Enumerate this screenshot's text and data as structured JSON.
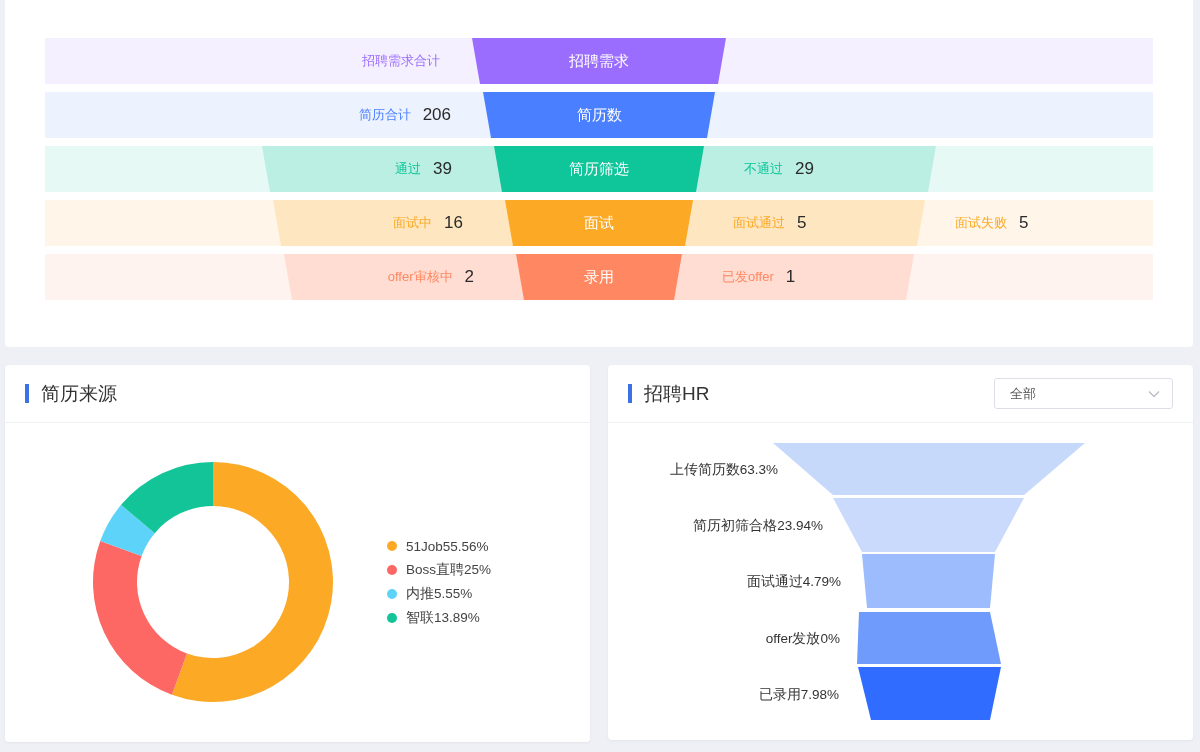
{
  "funnel": {
    "rows": [
      {
        "stage": "招聘需求",
        "color": "#9b6dff",
        "left": [
          {
            "label": "招聘需求合计",
            "shaded": false
          }
        ],
        "right": []
      },
      {
        "stage": "简历数",
        "color": "#4a80ff",
        "left": [
          {
            "label": "简历合计",
            "count": "206",
            "shaded": false
          }
        ],
        "right": []
      },
      {
        "stage": "简历筛选",
        "color": "#0fc69a",
        "left": [
          {
            "label": "通过",
            "count": "39",
            "shaded": true
          }
        ],
        "right": [
          {
            "label": "不通过",
            "count": "29",
            "shaded": true
          }
        ]
      },
      {
        "stage": "面试",
        "color": "#fca925",
        "left": [
          {
            "label": "面试中",
            "count": "16",
            "shaded": true
          }
        ],
        "right": [
          {
            "label": "面试通过",
            "count": "5",
            "shaded": true
          },
          {
            "label": "面试失败",
            "count": "5",
            "shaded": false
          }
        ]
      },
      {
        "stage": "录用",
        "color": "#ff8761",
        "left": [
          {
            "label": "offer审核中",
            "count": "2",
            "shaded": true
          }
        ],
        "right": [
          {
            "label": "已发offer",
            "count": "1",
            "shaded": true
          }
        ]
      }
    ]
  },
  "sources": {
    "title": "简历来源",
    "chart_data": {
      "type": "donut",
      "categories": [
        "51Job55.56%",
        "Boss直聘25%",
        "内推5.55%",
        "智联13.89%"
      ],
      "series": [
        {
          "values": [
            55.56,
            25,
            5.55,
            13.89
          ]
        }
      ]
    },
    "legend": [
      {
        "color": "#fca925"
      },
      {
        "color": "#fd6764"
      },
      {
        "color": "#5ed3f9"
      },
      {
        "color": "#12c497"
      }
    ]
  },
  "hr": {
    "title": "招聘HR",
    "filter": {
      "value": "全部"
    },
    "stages": [
      {
        "label": "上传简历数63.3%",
        "color": "#c6d9fb"
      },
      {
        "label": "简历初筛合格23.94%",
        "color": "#c9dafc"
      },
      {
        "label": "面试通过4.79%",
        "color": "#9cbcfd"
      },
      {
        "label": "offer发放0%",
        "color": "#6f9bfc"
      },
      {
        "label": "已录用7.98%",
        "color": "#2f6cff"
      }
    ]
  }
}
